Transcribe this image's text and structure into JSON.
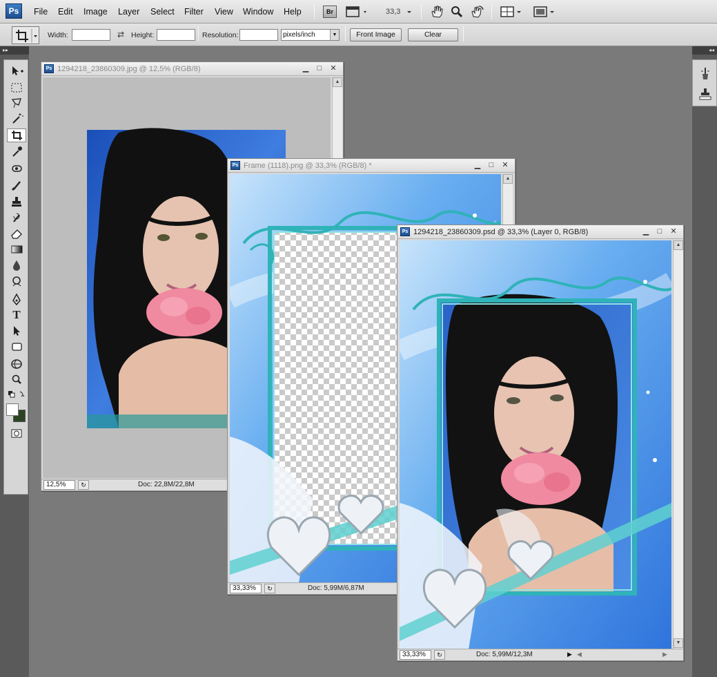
{
  "app": {
    "logo": "Ps"
  },
  "menu": [
    "File",
    "Edit",
    "Image",
    "Layer",
    "Select",
    "Filter",
    "View",
    "Window",
    "Help"
  ],
  "menubar": {
    "bridge_label": "Br",
    "zoom_value": "33,3",
    "icons": [
      "mini-bridge-icon",
      "zoom-level-dropdown",
      "hand-tool-icon",
      "zoom-tool-icon",
      "rotate-view-icon",
      "arrange-documents-icon",
      "screen-mode-icon"
    ]
  },
  "options": {
    "width_label": "Width:",
    "width_value": "",
    "height_label": "Height:",
    "height_value": "",
    "resolution_label": "Resolution:",
    "resolution_value": "",
    "units": "pixels/inch",
    "front_image_label": "Front Image",
    "clear_label": "Clear"
  },
  "toolbox": {
    "tools": [
      "move-tool",
      "rectangular-marquee-tool",
      "lasso-tool",
      "magic-wand-tool",
      "crop-tool",
      "eyedropper-tool",
      "spot-healing-tool",
      "brush-tool",
      "clone-stamp-tool",
      "history-brush-tool",
      "eraser-tool",
      "gradient-tool",
      "blur-tool",
      "dodge-tool",
      "pen-tool",
      "type-tool",
      "path-selection-tool",
      "rectangle-tool",
      "3d-rotate-tool",
      "zoom-tool"
    ],
    "active_tool": "crop-tool",
    "foreground_color": "#ffffff",
    "background_color": "#2d4424"
  },
  "documents": [
    {
      "title": "1294218_23860309.jpg @ 12,5% (RGB/8)",
      "zoom": "12,5%",
      "doc_size": "Doc: 22,8M/22,8M",
      "active": false
    },
    {
      "title": "Frame (1118).png @ 33,3% (RGB/8) *",
      "zoom": "33,33%",
      "doc_size": "Doc: 5,99M/6,87M",
      "active": false
    },
    {
      "title": "1294218_23860309.psd @ 33,3% (Layer 0, RGB/8)",
      "zoom": "33,33%",
      "doc_size": "Doc: 5,99M/12,3M",
      "active": true
    }
  ],
  "colors": {
    "ps_blue": "#1d4f91",
    "workspace_gray": "#7a7a7a",
    "frame_teal": "#2fb3b8",
    "sky_blue": "#4a8fe0"
  }
}
